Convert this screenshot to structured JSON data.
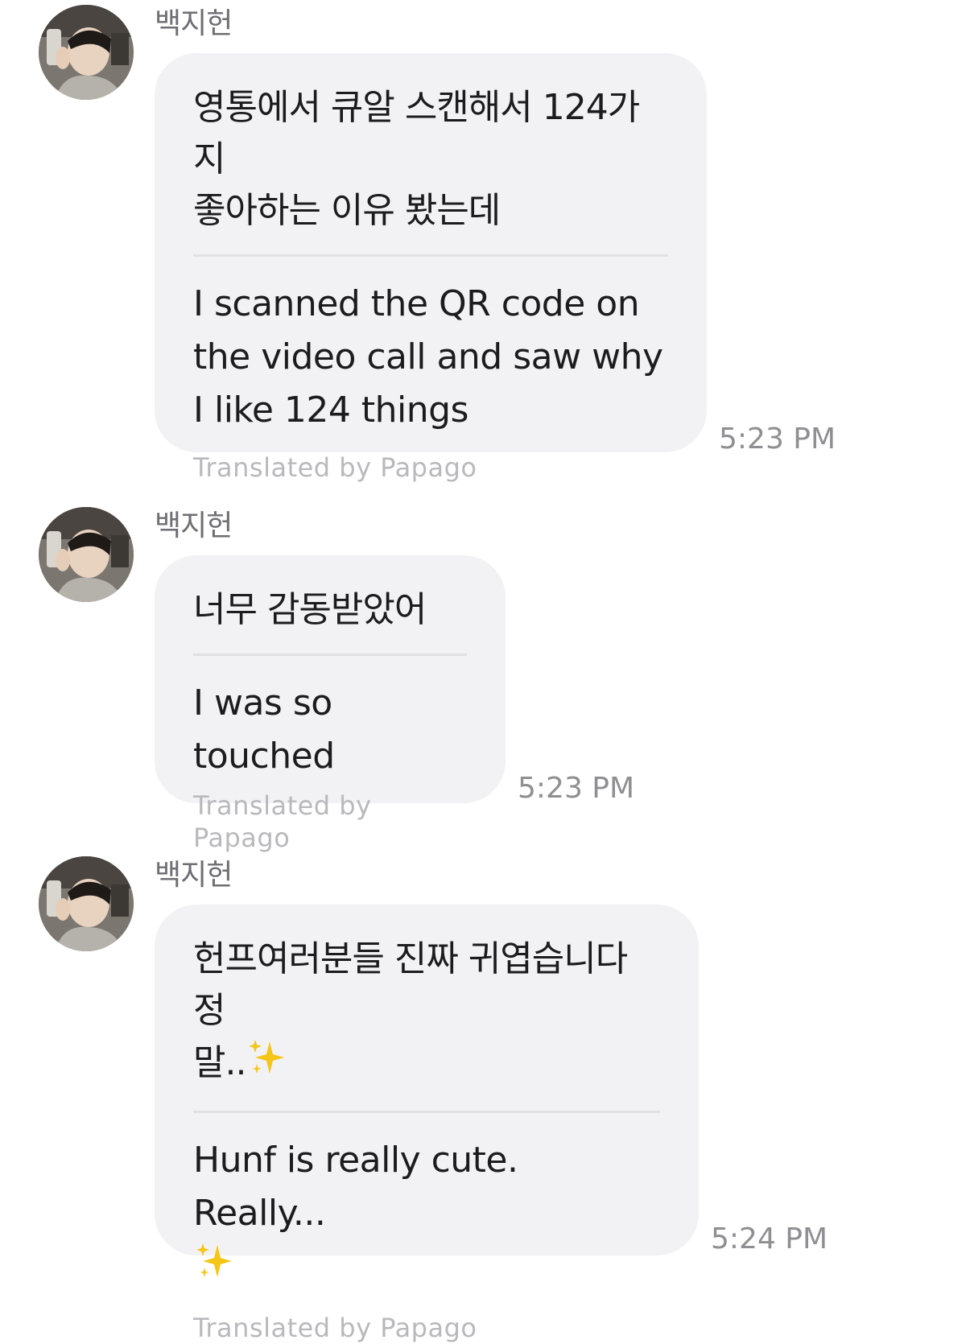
{
  "messages": [
    {
      "sender": "백지헌",
      "original": "영통에서 큐알 스캔해서 124가지\n좋아하는 이유 봤는데",
      "translated": "I scanned the QR code on the video call and saw why I like 124 things",
      "credit": "Translated by Papago",
      "time": "5:23 PM"
    },
    {
      "sender": "백지헌",
      "original": "너무 감동받았어",
      "translated": "I was so touched",
      "credit": "Translated by Papago",
      "time": "5:23 PM"
    },
    {
      "sender": "백지헌",
      "original": "헌프여러분들 진짜 귀엽습니다 정\n말..",
      "translated": "Hunf is really cute. Really...",
      "credit": "Translated by Papago",
      "time": "5:24 PM"
    }
  ],
  "icons": {
    "avatar": "profile-photo",
    "sparkles": "sparkles-emoji"
  },
  "colors": {
    "bubble": "#f2f2f4",
    "sparkle": "#f5c518"
  }
}
